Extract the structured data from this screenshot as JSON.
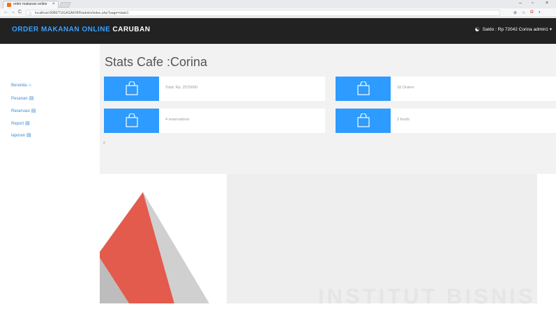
{
  "browser": {
    "tab_title": "order makanan online",
    "tab_close": "×",
    "url": "localhost:8080/TUGASAKHIR/admin/index.php?page=stats1",
    "nav_back": "←",
    "nav_forward": "→",
    "nav_reload": "C",
    "info_icon": "ⓘ",
    "win_min": "–",
    "win_max": "▫",
    "win_close": "×",
    "ext_search": "⊕",
    "ext_star": "☆",
    "ext_opera": "O",
    "ext_other": "◐"
  },
  "navbar": {
    "brand_part1": "ORDER MAKANAN ONLINE",
    "brand_part2": "CARUBAN",
    "user_text": "Saldo : Rp 72042 Corina admin1 ▾"
  },
  "sidebar": {
    "items": [
      {
        "label": "Beranda",
        "icon": "home-icon"
      },
      {
        "label": "Pesanan",
        "icon": "book-icon"
      },
      {
        "label": "Reservasi",
        "icon": "book-icon"
      },
      {
        "label": "Report",
        "icon": "book-icon"
      },
      {
        "label": "laporan",
        "icon": "book-icon"
      }
    ]
  },
  "main": {
    "title": "Stats Cafe :Corina",
    "cards": [
      {
        "text": "Total: Rp. 2570000",
        "icon": "shopping-bag-icon"
      },
      {
        "text": "18 Orders",
        "icon": "shopping-bag-icon"
      },
      {
        "text": "4 reservations",
        "icon": "shopping-bag-icon"
      },
      {
        "text": "3 foods",
        "icon": "shopping-bag-icon"
      }
    ],
    "note": "#"
  },
  "watermark": {
    "text": "INSTITUT BISNIS"
  },
  "colors": {
    "navbar_bg": "#222222",
    "brand_blue": "#3aa0ff",
    "card_icon_bg": "#2d9bff",
    "link_blue": "#3a8bd5",
    "main_bg": "#f2f2f2",
    "watermark_red": "#e0493a"
  }
}
